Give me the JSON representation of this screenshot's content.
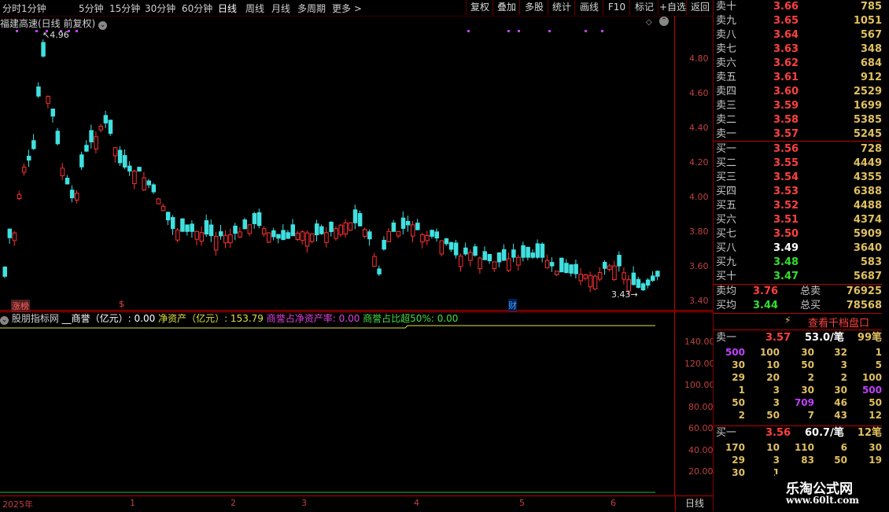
{
  "toolbar": {
    "periods": [
      "分时",
      "1分钟",
      "5分钟",
      "15分钟",
      "30分钟",
      "60分钟",
      "日线",
      "周线",
      "月线",
      "多周期",
      "更多 >"
    ],
    "active": "日线",
    "buttons": [
      "复权",
      "叠加",
      "多股",
      "统计",
      "画线",
      "F10",
      "标记",
      "+自选",
      "返回"
    ]
  },
  "chart": {
    "title": "福建高速(日线 前复权)",
    "high_label": "4.96",
    "low_label": "3.43",
    "yticks": [
      "4.80",
      "4.60",
      "4.40",
      "4.20",
      "4.00",
      "3.80",
      "3.60",
      "3.40"
    ],
    "markers": {
      "zhangbang": "涨榜",
      "dollar": "$",
      "cai": "财"
    }
  },
  "indicator": {
    "name": "股朋指标网",
    "f1_label": "__商誉（亿元）: 0.00",
    "f2_label": "净资产（亿元）: 153.79",
    "f3_label": "商誉占净资产率: 0.00",
    "f4_label": "商誉占比超50%: 0.00",
    "yticks": [
      "140.00",
      "120.00",
      "100.00",
      "80.00",
      "60.00",
      "40.00",
      "20.00"
    ]
  },
  "xaxis": {
    "labels": [
      "2025年",
      "1",
      "2",
      "3",
      "4",
      "5",
      "6"
    ],
    "period": "日线"
  },
  "book": {
    "asks": [
      {
        "label": "卖十",
        "price": "3.66",
        "vol": "785"
      },
      {
        "label": "卖九",
        "price": "3.65",
        "vol": "1051"
      },
      {
        "label": "卖八",
        "price": "3.64",
        "vol": "567"
      },
      {
        "label": "卖七",
        "price": "3.63",
        "vol": "348"
      },
      {
        "label": "卖六",
        "price": "3.62",
        "vol": "684"
      },
      {
        "label": "卖五",
        "price": "3.61",
        "vol": "912"
      },
      {
        "label": "卖四",
        "price": "3.60",
        "vol": "2529"
      },
      {
        "label": "卖三",
        "price": "3.59",
        "vol": "1699"
      },
      {
        "label": "卖二",
        "price": "3.58",
        "vol": "5385"
      },
      {
        "label": "卖一",
        "price": "3.57",
        "vol": "5245"
      }
    ],
    "bids": [
      {
        "label": "买一",
        "price": "3.56",
        "vol": "728"
      },
      {
        "label": "买二",
        "price": "3.55",
        "vol": "4449"
      },
      {
        "label": "买三",
        "price": "3.54",
        "vol": "4355"
      },
      {
        "label": "买四",
        "price": "3.53",
        "vol": "6388"
      },
      {
        "label": "买五",
        "price": "3.52",
        "vol": "4488"
      },
      {
        "label": "买六",
        "price": "3.51",
        "vol": "4374"
      },
      {
        "label": "买七",
        "price": "3.50",
        "vol": "5909"
      },
      {
        "label": "买八",
        "price": "3.49",
        "vol": "3640"
      },
      {
        "label": "买九",
        "price": "3.48",
        "vol": "583"
      },
      {
        "label": "买十",
        "price": "3.47",
        "vol": "5687"
      }
    ],
    "sell_avg": {
      "label": "卖均",
      "price": "3.76",
      "tlabel": "总卖",
      "vol": "76925"
    },
    "buy_avg": {
      "label": "买均",
      "price": "3.44",
      "tlabel": "总买",
      "vol": "78568"
    },
    "view_btn": "查看千档盘口",
    "ask1_summary": {
      "label": "卖一",
      "price": "3.57",
      "avg": "53.0/笔",
      "count": "99笔"
    },
    "ask1_grid": [
      [
        "500",
        "100",
        "30",
        "32",
        "1"
      ],
      [
        "30",
        "10",
        "50",
        "3",
        "5"
      ],
      [
        "29",
        "20",
        "2",
        "2",
        "100"
      ],
      [
        "1",
        "3",
        "30",
        "30",
        "500"
      ],
      [
        "50",
        "3",
        "709",
        "46",
        "50"
      ],
      [
        "2",
        "50",
        "7",
        "43",
        "12"
      ]
    ],
    "bid1_summary": {
      "label": "买一",
      "price": "3.56",
      "avg": "60.7/笔",
      "count": "12笔"
    },
    "bid1_grid": [
      [
        "170",
        "10",
        "110",
        "6",
        "30"
      ],
      [
        "29",
        "3",
        "83",
        "50",
        "19"
      ],
      [
        "30",
        "1"
      ]
    ]
  },
  "watermark": {
    "line1": "乐淘公式网",
    "line2": "www.60lt.com"
  },
  "colors": {
    "up": "#ff3030",
    "down": "#40e0e0",
    "axis": "#c00000",
    "yellow_line": "#e0e040",
    "green_line": "#20c020"
  }
}
